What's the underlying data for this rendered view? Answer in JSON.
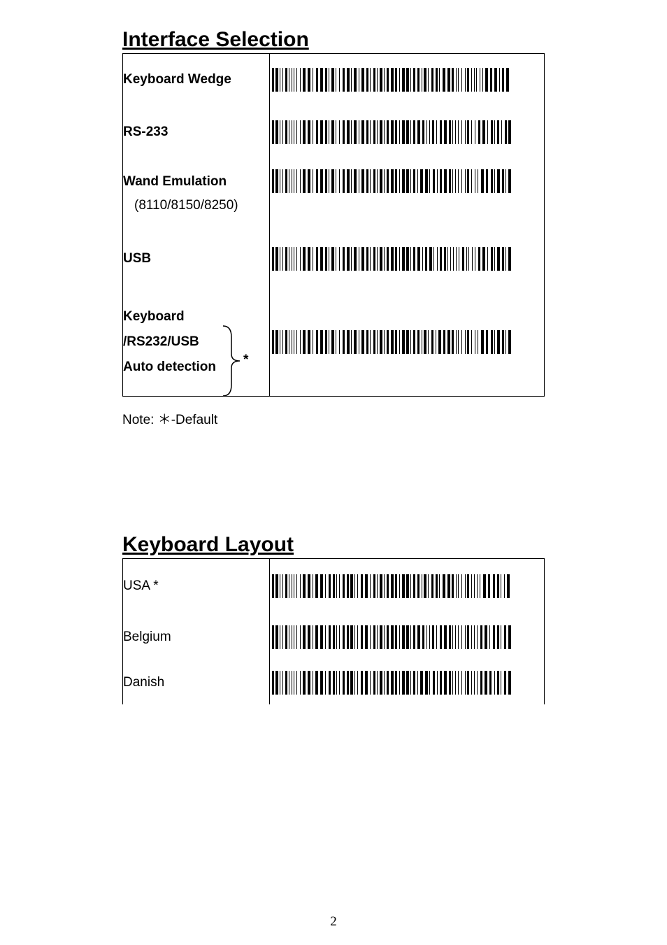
{
  "section1": {
    "heading": "Interface Selection",
    "rows": [
      {
        "label": "Keyboard Wedge",
        "bold": true,
        "sub": ""
      },
      {
        "label": "RS-233",
        "bold": true,
        "sub": ""
      },
      {
        "label": "Wand Emulation",
        "bold": true,
        "sub": "(8110/8150/8250)"
      },
      {
        "label": "USB",
        "bold": true,
        "sub": ""
      }
    ],
    "multi": {
      "line1": "Keyboard",
      "line2": "/RS232/USB",
      "line3": "Auto detection",
      "star": "*"
    }
  },
  "note": "Note: ＊-Default",
  "section2": {
    "heading": "Keyboard Layout",
    "rows": [
      {
        "label": "USA *"
      },
      {
        "label": "Belgium"
      },
      {
        "label": "Danish"
      }
    ]
  },
  "pageNumber": "2"
}
